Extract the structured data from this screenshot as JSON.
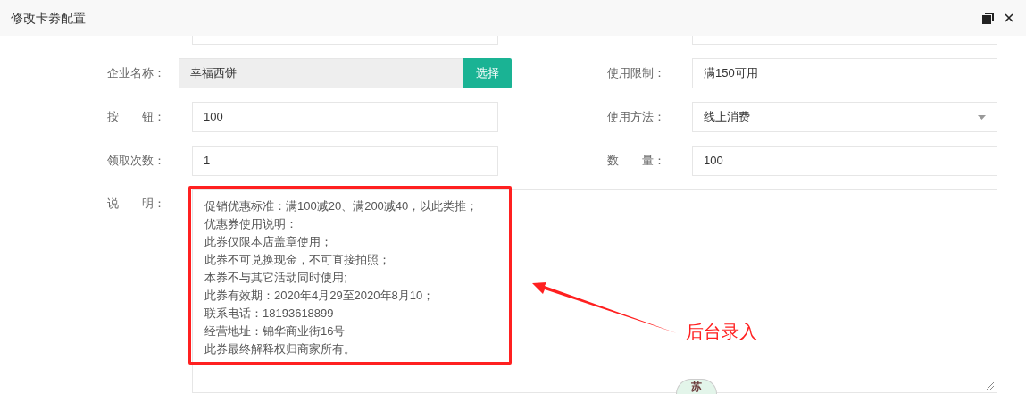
{
  "window": {
    "title": "修改卡劵配置"
  },
  "rows": [
    {
      "left": {
        "label": "企业名称：",
        "kind": "picker",
        "value": "幸福西饼",
        "button": "选择"
      },
      "right": {
        "label": "使用限制：",
        "kind": "text",
        "value": "满150可用"
      }
    },
    {
      "left": {
        "label": "按　　钮：",
        "kind": "text",
        "value": "100"
      },
      "right": {
        "label": "使用方法：",
        "kind": "select",
        "value": "线上消费"
      }
    },
    {
      "left": {
        "label": "领取次数：",
        "kind": "text",
        "value": "1"
      },
      "right": {
        "label": "数　　量：",
        "kind": "text",
        "value": "100"
      }
    }
  ],
  "description": {
    "label": "说　　明：",
    "lines": [
      "促销优惠标准：满100减20、满200减40，以此类推；",
      "优惠券使用说明：",
      "此券仅限本店盖章使用；",
      "此券不可兑换现金，不可直接拍照；",
      "本券不与其它活动同时使用;",
      "此券有效期：2020年4月29至2020年8月10；",
      "联系电话：18193618899",
      "经营地址：锦华商业街16号",
      "此券最终解释权归商家所有。"
    ]
  },
  "annotation": {
    "text": "后台录入"
  },
  "badge": {
    "text": "苏"
  }
}
